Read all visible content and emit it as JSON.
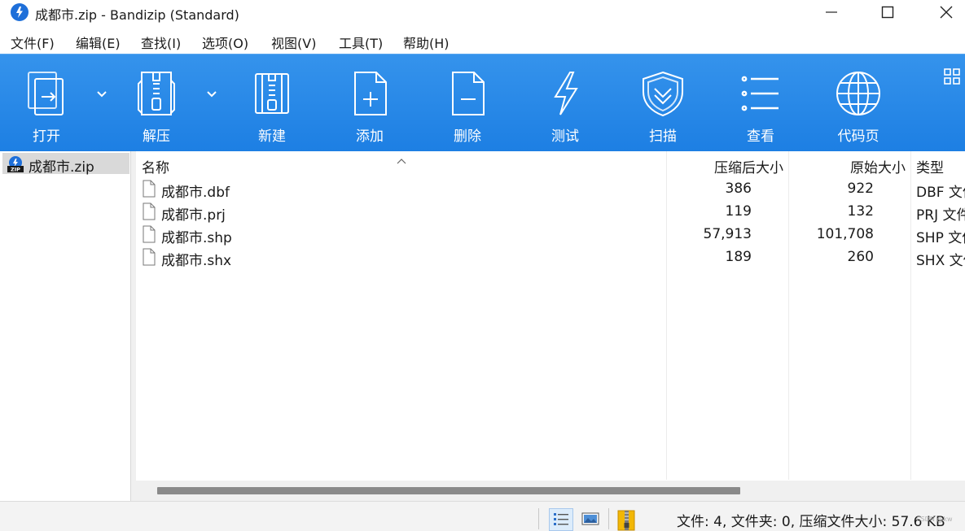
{
  "window": {
    "title": "成都市.zip - Bandizip (Standard)"
  },
  "menu": [
    {
      "label": "文件(F)"
    },
    {
      "label": "编辑(E)"
    },
    {
      "label": "查找(I)"
    },
    {
      "label": "选项(O)"
    },
    {
      "label": "视图(V)"
    },
    {
      "label": "工具(T)"
    },
    {
      "label": "帮助(H)"
    }
  ],
  "toolbar": {
    "open": "打开",
    "extract": "解压",
    "new": "新建",
    "add": "添加",
    "delete": "删除",
    "test": "测试",
    "scan": "扫描",
    "view": "查看",
    "codepage": "代码页"
  },
  "tree": {
    "root_label": "成都市.zip"
  },
  "columns": {
    "name": "名称",
    "compressed_size": "压缩后大小",
    "original_size": "原始大小",
    "type": "类型"
  },
  "files": [
    {
      "name": "成都市.dbf",
      "compressed_size": "386",
      "original_size": "922",
      "type": "DBF 文件"
    },
    {
      "name": "成都市.prj",
      "compressed_size": "119",
      "original_size": "132",
      "type": "PRJ 文件"
    },
    {
      "name": "成都市.shp",
      "compressed_size": "57,913",
      "original_size": "101,708",
      "type": "SHP 文件"
    },
    {
      "name": "成都市.shx",
      "compressed_size": "189",
      "original_size": "260",
      "type": "SHX 文件"
    }
  ],
  "status": {
    "summary": "文件: 4, 文件夹: 0, 压缩文件大小: 57.6 KB",
    "watermark": "CSDN @kw"
  },
  "colors": {
    "toolbar_top": "#3593ec",
    "toolbar_bottom": "#1d7fe3",
    "selection": "#d9d9d9"
  },
  "icons": {
    "app": "bandizip-logo-icon",
    "open": "open-archive-icon",
    "extract": "extract-zipper-icon",
    "new": "new-archive-icon",
    "add": "add-file-icon",
    "delete": "delete-file-icon",
    "test": "lightning-icon",
    "scan": "shield-icon",
    "view": "list-view-icon",
    "codepage": "globe-icon"
  }
}
